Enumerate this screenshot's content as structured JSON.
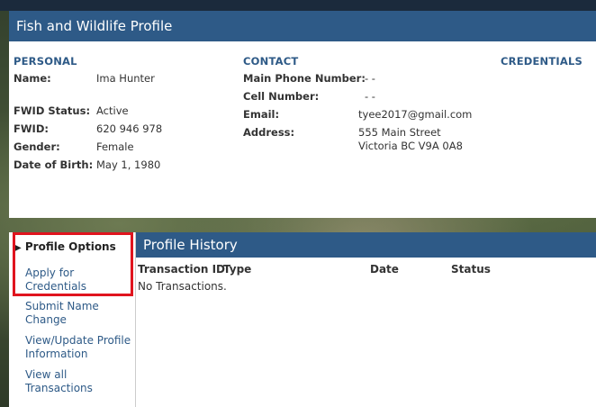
{
  "header": {
    "title": "Fish and Wildlife Profile"
  },
  "personal": {
    "title": "PERSONAL",
    "name_label": "Name:",
    "name_value": "Ima Hunter",
    "fwid_status_label": "FWID Status:",
    "fwid_status_value": "Active",
    "fwid_label": "FWID:",
    "fwid_value": "620 946 978",
    "gender_label": "Gender:",
    "gender_value": "Female",
    "dob_label": "Date of Birth:",
    "dob_value": "May 1, 1980"
  },
  "contact": {
    "title": "CONTACT",
    "main_phone_label": "Main Phone Number:",
    "main_phone_value": "- -",
    "cell_label": "Cell Number:",
    "cell_value": "- -",
    "email_label": "Email:",
    "email_value": "tyee2017@gmail.com",
    "address_label": "Address:",
    "address_line1": "555 Main Street",
    "address_line2": "Victoria BC V9A 0A8"
  },
  "credentials": {
    "title": "CREDENTIALS"
  },
  "options": {
    "title": "Profile Options",
    "items": [
      {
        "line1": "Apply for",
        "line2": "Credentials"
      },
      {
        "line1": "Submit Name",
        "line2": "Change"
      },
      {
        "line1": "View/Update Profile",
        "line2": "Information"
      },
      {
        "line1": "View all",
        "line2": "Transactions"
      }
    ]
  },
  "history": {
    "title": "Profile History",
    "columns": [
      "Transaction ID",
      "Type",
      "Date",
      "Status"
    ],
    "empty_text": "No Transactions."
  }
}
